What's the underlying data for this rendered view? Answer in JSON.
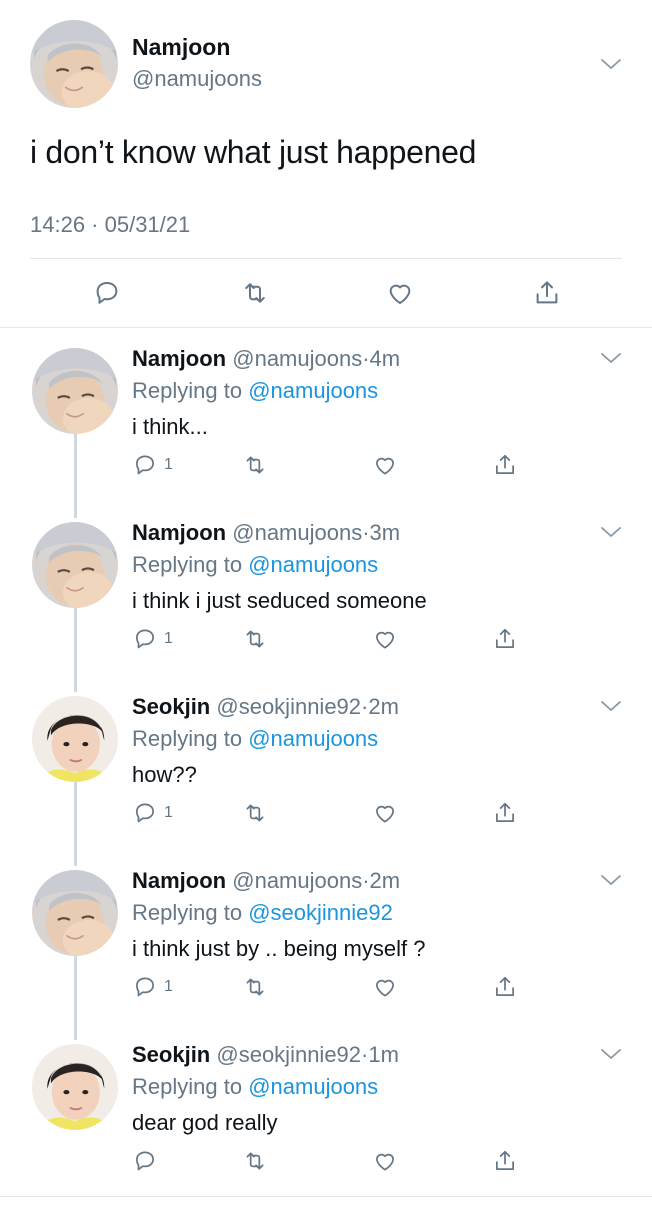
{
  "main_tweet": {
    "author_name": "Namjoon",
    "author_handle": "@namujoons",
    "text": "i don’t know what just happened",
    "timestamp": "14:26 · 05/31/21",
    "actions": [
      "reply-icon",
      "retweet-icon",
      "like-icon",
      "share-icon"
    ]
  },
  "replies": [
    {
      "name": "Namjoon",
      "handle": "@namujoons",
      "dot": "·",
      "time": "4m",
      "replying_prefix": "Replying to",
      "replying_to": "@namujoons",
      "text": "i think...",
      "reply_count": "1"
    },
    {
      "name": "Namjoon",
      "handle": "@namujoons",
      "dot": "·",
      "time": "3m",
      "replying_prefix": "Replying to",
      "replying_to": "@namujoons",
      "text": "i think i just seduced someone",
      "reply_count": "1"
    },
    {
      "name": "Seokjin",
      "handle": "@seokjinnie92",
      "dot": "·",
      "time": "2m",
      "replying_prefix": "Replying to",
      "replying_to": "@namujoons",
      "text": "how??",
      "reply_count": "1"
    },
    {
      "name": "Namjoon",
      "handle": "@namujoons",
      "dot": "·",
      "time": "2m",
      "replying_prefix": "Replying to",
      "replying_to": "@seokjinnie92",
      "text": "i think just by .. being myself ?",
      "reply_count": "1"
    },
    {
      "name": "Seokjin",
      "handle": "@seokjinnie92",
      "dot": "·",
      "time": "1m",
      "replying_prefix": "Replying to",
      "replying_to": "@namujoons",
      "text": "dear god really",
      "reply_count": ""
    }
  ],
  "colors": {
    "text": "#0f1419",
    "secondary": "#657786",
    "link": "#1b95e0",
    "divider": "#e1e8ed",
    "thread_line": "#cfd9de"
  }
}
